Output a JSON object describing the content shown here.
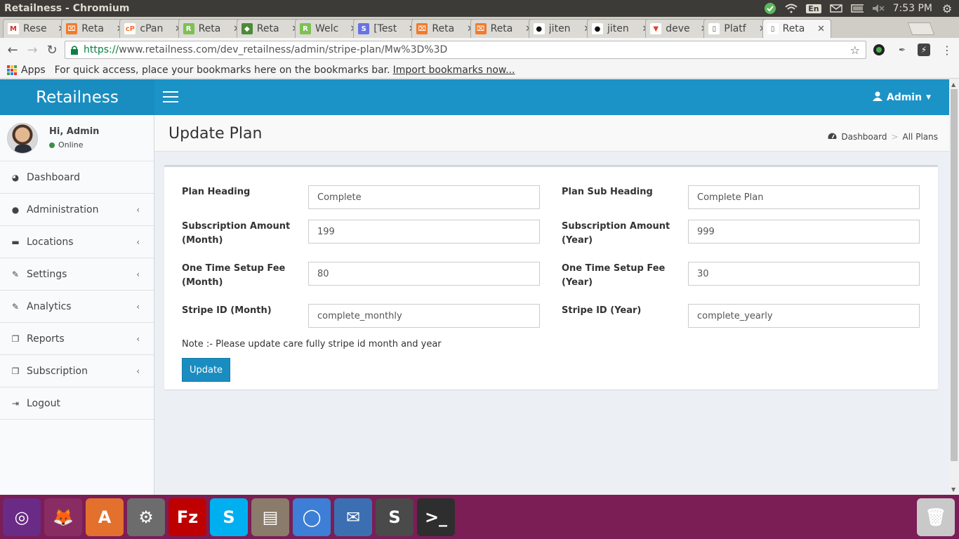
{
  "os": {
    "window_title": "Retailness - Chromium",
    "lang": "En",
    "time": "7:53 PM"
  },
  "tabs": [
    {
      "label": "Rese",
      "icon": "gmail-icon",
      "color": "#ffffff",
      "glyph": "M",
      "glyph_color": "#d93025"
    },
    {
      "label": "Reta",
      "icon": "xampp-icon",
      "color": "#f27b2b",
      "glyph": "⌧",
      "glyph_color": "#ffffff"
    },
    {
      "label": "cPan",
      "icon": "cpanel-icon",
      "color": "#ffffff",
      "glyph": "cP",
      "glyph_color": "#ff6c2c"
    },
    {
      "label": "Reta",
      "icon": "r-icon",
      "color": "#7cc151",
      "glyph": "R",
      "glyph_color": "#ffffff"
    },
    {
      "label": "Reta",
      "icon": "shield-icon",
      "color": "#4c8a3a",
      "glyph": "◆",
      "glyph_color": "#ffffff"
    },
    {
      "label": "Welc",
      "icon": "r-icon",
      "color": "#7cc151",
      "glyph": "R",
      "glyph_color": "#ffffff"
    },
    {
      "label": "[Test",
      "icon": "stripe-icon",
      "color": "#6772e5",
      "glyph": "S",
      "glyph_color": "#ffffff"
    },
    {
      "label": "Reta",
      "icon": "xampp-icon",
      "color": "#f27b2b",
      "glyph": "⌧",
      "glyph_color": "#ffffff"
    },
    {
      "label": "Reta",
      "icon": "xampp-icon",
      "color": "#f27b2b",
      "glyph": "⌧",
      "glyph_color": "#ffffff"
    },
    {
      "label": "jiten",
      "icon": "github-icon",
      "color": "#ffffff",
      "glyph": "●",
      "glyph_color": "#111111"
    },
    {
      "label": "jiten",
      "icon": "github-icon",
      "color": "#ffffff",
      "glyph": "●",
      "glyph_color": "#111111"
    },
    {
      "label": "deve",
      "icon": "gitlab-icon",
      "color": "#ffffff",
      "glyph": "▼",
      "glyph_color": "#e24329"
    },
    {
      "label": "Platf",
      "icon": "page-icon",
      "color": "#ffffff",
      "glyph": "▯",
      "glyph_color": "#555555"
    },
    {
      "label": "Reta",
      "icon": "page-icon",
      "color": "#ffffff",
      "glyph": "▯",
      "glyph_color": "#555555",
      "active": true
    }
  ],
  "address": {
    "https": "https://",
    "rest": "www.retailness.com/dev_retailness/admin/stripe-plan/Mw%3D%3D"
  },
  "bookmarks": {
    "apps": "Apps",
    "hint": "For quick access, place your bookmarks here on the bookmarks bar.",
    "import": "Import bookmarks now..."
  },
  "app": {
    "brand": "Retailness",
    "admin_label": "Admin",
    "user": {
      "greeting": "Hi, Admin",
      "status": "Online"
    },
    "menu": [
      {
        "label": "Dashboard",
        "icon": "dashboard-icon",
        "glyph": "◕",
        "chevron": false
      },
      {
        "label": "Administration",
        "icon": "user-icon",
        "glyph": "●",
        "chevron": true
      },
      {
        "label": "Locations",
        "icon": "cart-icon",
        "glyph": "▬",
        "chevron": true
      },
      {
        "label": "Settings",
        "icon": "edit-icon",
        "glyph": "✎",
        "chevron": true
      },
      {
        "label": "Analytics",
        "icon": "edit-icon",
        "glyph": "✎",
        "chevron": true
      },
      {
        "label": "Reports",
        "icon": "copy-icon",
        "glyph": "❐",
        "chevron": true
      },
      {
        "label": "Subscription",
        "icon": "copy-icon",
        "glyph": "❐",
        "chevron": true
      },
      {
        "label": "Logout",
        "icon": "sign-out-icon",
        "glyph": "⇥",
        "chevron": false
      }
    ],
    "page_title": "Update Plan",
    "breadcrumb": {
      "home": "Dashboard",
      "current": "All Plans"
    },
    "form": {
      "plan_heading": {
        "label": "Plan Heading",
        "value": "Complete"
      },
      "plan_sub_heading": {
        "label": "Plan Sub Heading",
        "value": "Complete Plan"
      },
      "sub_amount_month": {
        "label_1": "Subscription Amount",
        "label_2": "(Month)",
        "value": "199"
      },
      "sub_amount_year": {
        "label_1": "Subscription Amount",
        "label_2": "(Year)",
        "value": "999"
      },
      "setup_fee_month": {
        "label_1": "One Time Setup Fee",
        "label_2": "(Month)",
        "value": "80"
      },
      "setup_fee_year": {
        "label_1": "One Time Setup Fee",
        "label_2": "(Year)",
        "value": "30"
      },
      "stripe_id_month": {
        "label": "Stripe ID (Month)",
        "value": "complete_monthly"
      },
      "stripe_id_year": {
        "label": "Stripe ID (Year)",
        "value": "complete_yearly"
      },
      "note": "Note :- Please update care fully stripe id month and year",
      "update_label": "Update"
    },
    "colors": {
      "primary": "#1b93c7",
      "brand_bg": "#1a8dc0",
      "online": "#3c8f45"
    }
  },
  "dock": [
    {
      "name": "ubuntu-dash-icon",
      "bg": "#6a2b86",
      "glyph": "◎"
    },
    {
      "name": "firefox-icon",
      "bg": "#8a2c64",
      "glyph": "🦊"
    },
    {
      "name": "software-center-icon",
      "bg": "#e4702d",
      "glyph": "A"
    },
    {
      "name": "system-settings-icon",
      "bg": "#6c6c6c",
      "glyph": "⚙"
    },
    {
      "name": "filezilla-icon",
      "bg": "#bf0000",
      "glyph": "Fz"
    },
    {
      "name": "skype-icon",
      "bg": "#00aff0",
      "glyph": "S"
    },
    {
      "name": "files-icon",
      "bg": "#8a7b6a",
      "glyph": "▤"
    },
    {
      "name": "chromium-icon",
      "bg": "#3d7fd6",
      "glyph": "◯"
    },
    {
      "name": "thunderbird-icon",
      "bg": "#3b6fb2",
      "glyph": "✉"
    },
    {
      "name": "sublime-text-icon",
      "bg": "#4a4a4a",
      "glyph": "S"
    },
    {
      "name": "terminal-icon",
      "bg": "#2e2e2e",
      "glyph": ">_"
    },
    {
      "name": "trash-icon",
      "bg": "#c9c9c9",
      "glyph": "🗑"
    }
  ]
}
